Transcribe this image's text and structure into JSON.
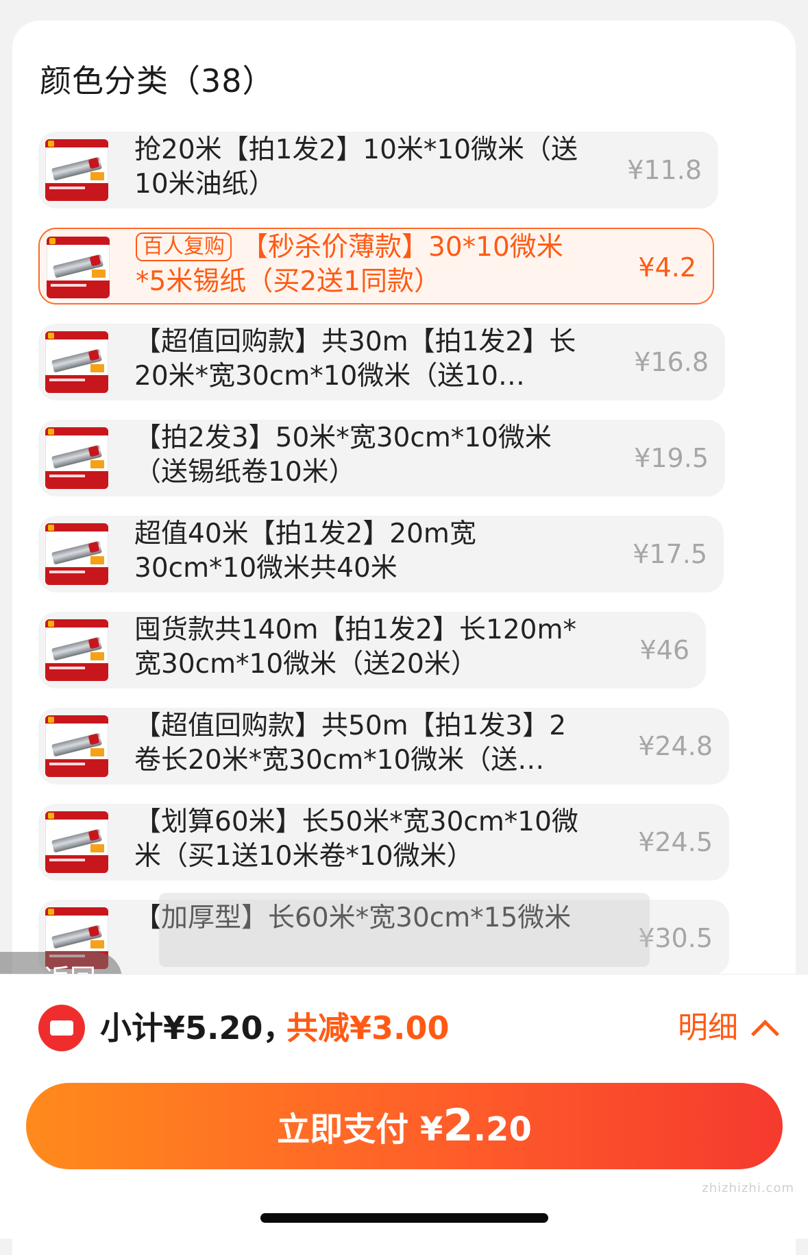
{
  "title": "颜色分类（38）",
  "items": [
    {
      "text": "抢20米【拍1发2】10米*10微米（送10米油纸）",
      "price": "¥11.8",
      "selected": false
    },
    {
      "pill": "百人复购",
      "text": "【秒杀价薄款】30*10微米*5米锡纸（买2送1同款）",
      "price": "¥4.2",
      "selected": true
    },
    {
      "text": "【超值回购款】共30m【拍1发2】长20米*宽30cm*10微米（送10…",
      "price": "¥16.8",
      "selected": false
    },
    {
      "text": "【拍2发3】50米*宽30cm*10微米（送锡纸卷10米）",
      "price": "¥19.5",
      "selected": false
    },
    {
      "text": "超值40米【拍1发2】20m宽30cm*10微米共40米",
      "price": "¥17.5",
      "selected": false
    },
    {
      "text": "囤货款共140m【拍1发2】长120m*宽30cm*10微米（送20米）",
      "price": "¥46",
      "selected": false
    },
    {
      "text": "【超值回购款】共50m【拍1发3】2卷长20米*宽30cm*10微米（送…",
      "price": "¥24.8",
      "selected": false
    },
    {
      "text": "【划算60米】长50米*宽30cm*10微米（买1送10米卷*10微米）",
      "price": "¥24.5",
      "selected": false
    },
    {
      "text": "【加厚型】长60米*宽30cm*15微米",
      "price": "¥30.5",
      "selected": false
    }
  ],
  "back": {
    "label": "返回"
  },
  "summary": {
    "subtotal": "小计¥5.20，",
    "discount": "共减¥3.00",
    "detail": "明细"
  },
  "pay": {
    "label": "立即支付 ¥",
    "amount_int": "2",
    "amount_dec": ".20"
  },
  "watermark": "zhizhizhi.com",
  "colors": {
    "accent": "#ff5a14",
    "button_start": "#ff8a1c",
    "button_end": "#f53a2e"
  }
}
